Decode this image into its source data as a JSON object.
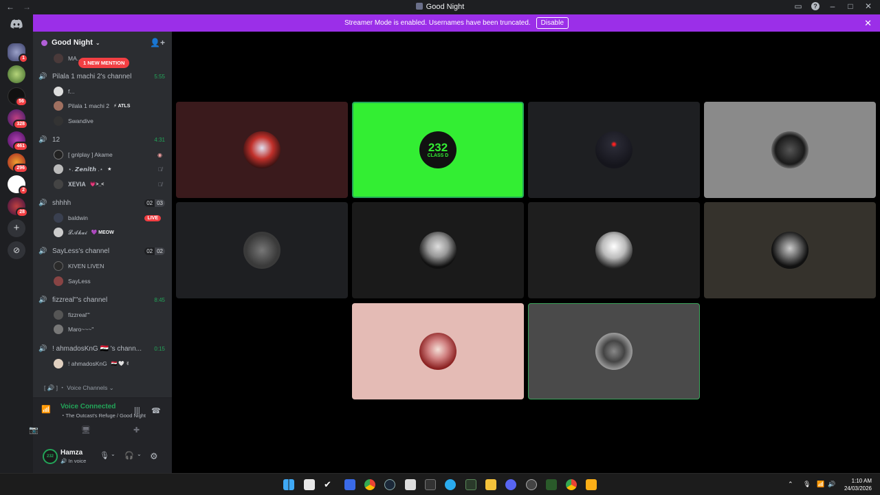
{
  "window": {
    "title": "Good Night",
    "nav_back": "←",
    "nav_forward": "→"
  },
  "banner": {
    "text": "Streamer Mode is enabled. Usernames have been truncated.",
    "button": "Disable",
    "close": "✕"
  },
  "rail": {
    "badges": [
      "1",
      "56",
      "328",
      "461",
      "296",
      "2",
      "28"
    ]
  },
  "server": {
    "name": "Good Night",
    "mention_pill": "1 NEW MENTION",
    "top_user": "MA..."
  },
  "channels": [
    {
      "name": "Pilala 1 machi 2's channel",
      "time": "5:55",
      "users": [
        {
          "name": "f..."
        },
        {
          "name": "Pilala 1 machi 2",
          "tag": "⚡ ATLS"
        },
        {
          "name": "Swandive"
        }
      ]
    },
    {
      "name": "12",
      "time": "4:31",
      "users": [
        {
          "name": "[ gnlplay ] Akame"
        },
        {
          "name": "⋆. 𝙕𝙚𝙣𝙞𝙩𝙝 .⋆",
          "tag": "★"
        },
        {
          "name": "𝐗𝐄𝐕𝐈𝐀",
          "tag": "💗>_<"
        }
      ]
    },
    {
      "name": "shhhh",
      "count_a": "02",
      "count_b": "03",
      "users": [
        {
          "name": "baldwin",
          "live": "LIVE"
        },
        {
          "name": "𝓛𝓐𝓴𝓪𝓲",
          "tag": "💜 MEOW"
        }
      ]
    },
    {
      "name": "SayLess's channel",
      "count_a": "02",
      "count_b": "02",
      "users": [
        {
          "name": "KIVEN LIVEN"
        },
        {
          "name": "SayLess"
        }
      ]
    },
    {
      "name": "fizzreal'''s channel",
      "time": "8:45",
      "users": [
        {
          "name": "fizzreal'''"
        },
        {
          "name": "Maro~~~''"
        }
      ]
    },
    {
      "name": "! ahmadosKnG 🇮🇶 's chann...",
      "time": "0:15",
      "users": [
        {
          "name": "! ahmadosKnG",
          "tag": "🇮🇶 🤍 ✌"
        }
      ]
    }
  ],
  "voice_category": "[ 🔊 ] ・ Voice Channels ⌄",
  "voice_panel": {
    "title": "Voice Connected",
    "subtitle": "・The Outcast's Refuge / Good Night"
  },
  "user_panel": {
    "name": "Hamza",
    "status": "🔊 In voice",
    "avatar_text": "232"
  },
  "tiles": [
    {
      "bg": "#3a1a1c"
    },
    {
      "bg": "#33ee33",
      "label": "232",
      "sublabel": "CLASS D"
    },
    {
      "bg": "#1e1f22"
    },
    {
      "bg": "#8a8a8a"
    },
    {
      "bg": "#1e1f22"
    },
    {
      "bg": "#1a1a1a"
    },
    {
      "bg": "#1e1e1e"
    },
    {
      "bg": "#35322c"
    },
    {
      "bg": "#e4bbb5"
    },
    {
      "bg": "#4a4a4a"
    }
  ],
  "clock": {
    "time": "1:10 AM",
    "date": "24/03/2026"
  },
  "colors": {
    "accent_green": "#23a559",
    "banner_purple": "#9b2fe8",
    "mention_red": "#f23f43"
  }
}
